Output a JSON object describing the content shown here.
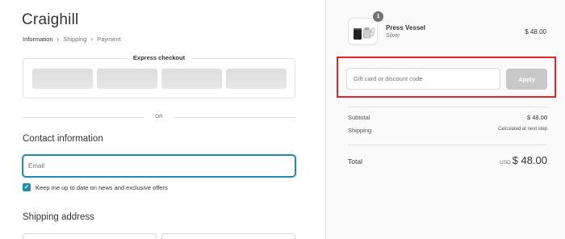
{
  "store": {
    "name": "Craighill"
  },
  "breadcrumb": {
    "information": "Information",
    "shipping": "Shipping",
    "payment": "Payment"
  },
  "express": {
    "title": "Express checkout"
  },
  "divider": {
    "or": "OR"
  },
  "contact": {
    "heading": "Contact information",
    "email_placeholder": "Email",
    "email_value": "",
    "newsletter_label": "Keep me up to date on news and exclusive offers",
    "newsletter_checked": true
  },
  "shipping": {
    "heading": "Shipping address"
  },
  "cart": {
    "product_name": "Press Vessel",
    "product_variant": "Silver",
    "product_price": "$ 48.00",
    "quantity": "1"
  },
  "discount": {
    "placeholder": "Gift card or discount code",
    "apply_label": "Apply"
  },
  "summary": {
    "subtotal_label": "Subtotal",
    "subtotal_value": "$ 48.00",
    "shipping_label": "Shipping",
    "shipping_value": "Calculated at next step",
    "total_label": "Total",
    "currency": "USD",
    "total_value": "$ 48.00"
  },
  "colors": {
    "accent": "#1f8bb3",
    "highlight": "#e0262a",
    "button_disabled": "#c8c8c8"
  }
}
